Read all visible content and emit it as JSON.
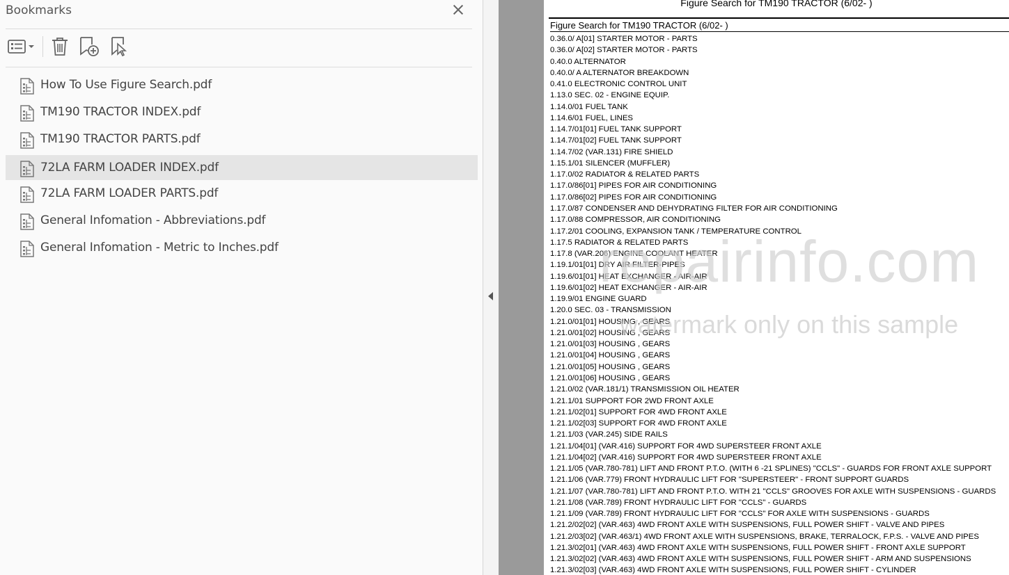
{
  "bookmarks_panel": {
    "title": "Bookmarks",
    "close_icon": "close-icon",
    "toolbar": {
      "options_icon": "list-options-icon",
      "delete_icon": "trash-icon",
      "new_bookmark_icon": "bookmark-add-icon",
      "bookmark_from_selection_icon": "bookmark-selection-icon"
    },
    "items": [
      {
        "label": "How To Use Figure Search.pdf",
        "icon": "pdf-attachment-icon"
      },
      {
        "label": "TM190 TRACTOR INDEX.pdf",
        "icon": "pdf-attachment-icon"
      },
      {
        "label": "TM190 TRACTOR PARTS.pdf",
        "icon": "pdf-attachment-icon"
      },
      {
        "label": "72LA FARM LOADER INDEX.pdf",
        "icon": "pdf-attachment-icon",
        "selected": true
      },
      {
        "label": "72LA FARM LOADER PARTS.pdf",
        "icon": "pdf-attachment-icon"
      },
      {
        "label": "General Infomation - Abbreviations.pdf",
        "icon": "pdf-attachment-icon"
      },
      {
        "label": "General Infomation - Metric to Inches.pdf",
        "icon": "pdf-attachment-icon"
      }
    ]
  },
  "document": {
    "heading": "Figure Search for TM190 TRACTOR (6/02- )",
    "subheading": "Figure Search for TM190 TRACTOR (6/02- )",
    "lines": [
      "0.36.0/  A[01] STARTER MOTOR - PARTS",
      "0.36.0/  A[02] STARTER MOTOR - PARTS",
      "0.40.0 ALTERNATOR",
      "0.40.0/  A ALTERNATOR BREAKDOWN",
      "0.41.0 ELECTRONIC CONTROL UNIT",
      "1.13.0 SEC. 02 - ENGINE EQUIP.",
      "1.14.0/01 FUEL TANK",
      "1.14.6/01 FUEL, LINES",
      "1.14.7/01[01] FUEL TANK SUPPORT",
      "1.14.7/01[02] FUEL TANK SUPPORT",
      "1.14.7/02 (VAR.131) FIRE SHIELD",
      "1.15.1/01 SILENCER (MUFFLER)",
      "1.17.0/02 RADIATOR & RELATED PARTS",
      "1.17.0/86[01] PIPES FOR AIR CONDITIONING",
      "1.17.0/86[02] PIPES FOR AIR CONDITIONING",
      "1.17.0/87 CONDENSER AND DEHYDRATING FILTER FOR AIR CONDITIONING",
      "1.17.0/88 COMPRESSOR, AIR CONDITIONING",
      "1.17.2/01 COOLING, EXPANSION TANK / TEMPERATURE CONTROL",
      "1.17.5 RADIATOR & RELATED PARTS",
      "1.17.8 (VAR.206) ENGINE COOLANT HEATER",
      "1.19.1/01[01] DRY AIR FILTER-PIPES",
      "1.19.6/01[01] HEAT EXCHANGER - AIR-AIR",
      "1.19.6/01[02] HEAT EXCHANGER - AIR-AIR",
      "1.19.9/01 ENGINE GUARD",
      "1.20.0 SEC. 03 - TRANSMISSION",
      "1.21.0/01[01] HOUSING , GEARS",
      "1.21.0/01[02] HOUSING , GEARS",
      "1.21.0/01[03] HOUSING , GEARS",
      "1.21.0/01[04] HOUSING , GEARS",
      "1.21.0/01[05] HOUSING , GEARS",
      "1.21.0/01[06] HOUSING , GEARS",
      "1.21.0/02 (VAR.181/1) TRANSMISSION OIL HEATER",
      "1.21.1/01 SUPPORT FOR 2WD FRONT AXLE",
      "1.21.1/02[01] SUPPORT FOR 4WD FRONT AXLE",
      "1.21.1/02[03] SUPPORT FOR 4WD FRONT AXLE",
      "1.21.1/03 (VAR.245) SIDE RAILS",
      "1.21.1/04[01] (VAR.416) SUPPORT FOR 4WD SUPERSTEER FRONT AXLE",
      "1.21.1/04[02] (VAR.416) SUPPORT FOR 4WD SUPERSTEER FRONT AXLE",
      "1.21.1/05 (VAR.780-781) LIFT AND FRONT P.T.O. (WITH 6 -21 SPLINES) \"CCLS\" - GUARDS FOR FRONT AXLE SUPPORT",
      "1.21.1/06 (VAR.779) FRONT HYDRAULIC LIFT FOR \"SUPERSTEER\" - FRONT SUPPORT GUARDS",
      "1.21.1/07 (VAR.780-781) LIFT AND FRONT P.T.O. WITH 21 \"CCLS\" GROOVES FOR AXLE WITH SUSPENSIONS - GUARDS",
      "1.21.1/08 (VAR.789) FRONT HYDRAULIC LIFT FOR \"CCLS\" - GUARDS",
      "1.21.1/09 (VAR.789) FRONT HYDRAULIC LIFT FOR \"CCLS\" FOR AXLE WITH SUSPENSIONS - GUARDS",
      "1.21.2/02[02] (VAR.463) 4WD FRONT AXLE WITH SUSPENSIONS, FULL POWER SHIFT - VALVE AND PIPES",
      "1.21.2/03[02] (VAR.463/1) 4WD FRONT AXLE WITH SUSPENSIONS, BRAKE, TERRALOCK, F.P.S. - VALVE AND PIPES",
      "1.21.3/02[01] (VAR.463) 4WD FRONT AXLE WITH SUSPENSIONS, FULL POWER SHIFT - FRONT AXLE SUPPORT",
      "1.21.3/02[02] (VAR.463) 4WD FRONT AXLE WITH SUSPENSIONS, FULL POWER SHIFT - ARM AND SUSPENSIONS",
      "1.21.3/02[03] (VAR.463) 4WD FRONT AXLE WITH SUSPENSIONS, FULL POWER SHIFT - CYLINDER"
    ],
    "watermark_main": "repairinfo.com",
    "watermark_sub": "watermark only on this sample"
  },
  "collapse_icon": "collapse-arrow-icon"
}
